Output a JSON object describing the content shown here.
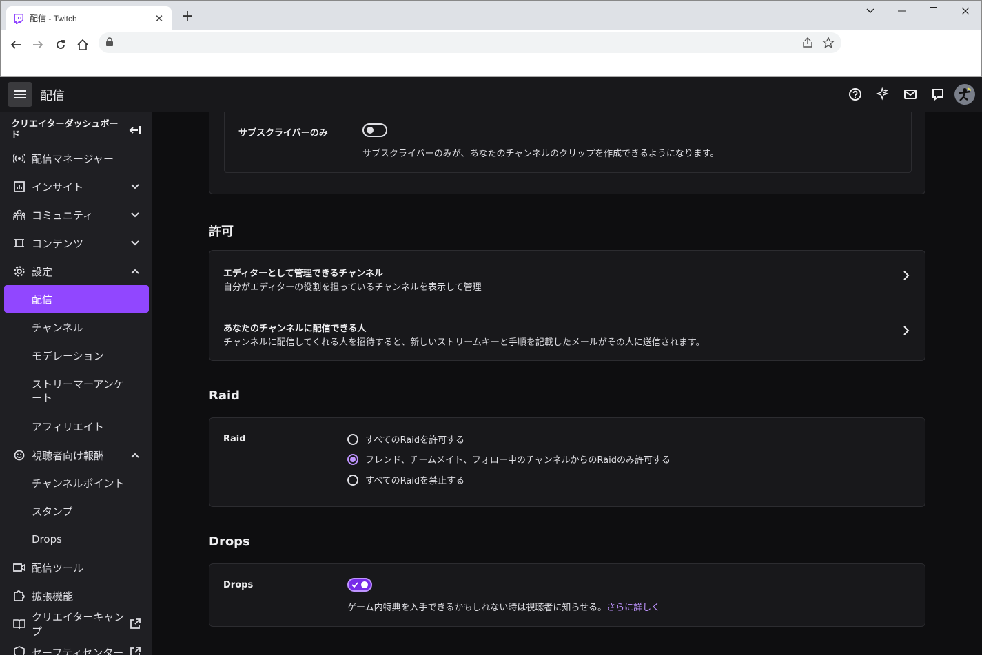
{
  "browser": {
    "tab_title": "配信 - Twitch",
    "window_controls": [
      "minimize",
      "maximize",
      "close"
    ]
  },
  "topbar": {
    "title": "配信"
  },
  "sidebar": {
    "header": "クリエイターダッシュボード",
    "items": [
      {
        "label": "配信マネージャー",
        "icon": "broadcast-icon"
      },
      {
        "label": "インサイト",
        "icon": "chart-icon",
        "expanded": false
      },
      {
        "label": "コミュニティ",
        "icon": "community-icon",
        "expanded": false
      },
      {
        "label": "コンテンツ",
        "icon": "content-icon",
        "expanded": false
      },
      {
        "label": "設定",
        "icon": "gear-icon",
        "expanded": true
      }
    ],
    "settings_sub": [
      "配信",
      "チャンネル",
      "モデレーション",
      "ストリーマーアンケート",
      "アフィリエイト"
    ],
    "rewards": {
      "label": "視聴者向け報酬",
      "icon": "smile-icon",
      "expanded": true
    },
    "rewards_sub": [
      "チャンネルポイント",
      "スタンプ",
      "Drops"
    ],
    "bottom_items": [
      {
        "label": "配信ツール",
        "icon": "camera-icon"
      },
      {
        "label": "拡張機能",
        "icon": "puzzle-icon"
      },
      {
        "label": "クリエイターキャンプ",
        "icon": "book-icon"
      },
      {
        "label": "セーフティセンター",
        "icon": "shield-icon"
      }
    ]
  },
  "clips": {
    "subscribers_only_label": "サブスクライバーのみ",
    "subscribers_only_desc": "サブスクライバーのみが、あなたのチャンネルのクリップを作成できるようになります。",
    "subscribers_only_on": false
  },
  "permissions": {
    "title": "許可",
    "rows": [
      {
        "title": "エディターとして管理できるチャンネル",
        "desc": "自分がエディターの役割を担っているチャンネルを表示して管理"
      },
      {
        "title": "あなたのチャンネルに配信できる人",
        "desc": "チャンネルに配信してくれる人を招待すると、新しいストリームキーと手順を記載したメールがその人に送信されます。"
      }
    ]
  },
  "raid": {
    "title": "Raid",
    "label": "Raid",
    "options": [
      {
        "label": "すべてのRaidを許可する",
        "selected": false
      },
      {
        "label": "フレンド、チームメイト、フォロー中のチャンネルからのRaidのみ許可する",
        "selected": true
      },
      {
        "label": "すべてのRaidを禁止する",
        "selected": false
      }
    ]
  },
  "drops": {
    "title": "Drops",
    "label": "Drops",
    "enabled": true,
    "desc": "ゲーム内特典を入手できるかもしれない時は視聴者に知らせる。",
    "link": "さらに詳しく"
  },
  "colors": {
    "accent": "#9147ff",
    "link": "#bf94ff",
    "bg": "#0e0e10",
    "card": "#18181b"
  }
}
